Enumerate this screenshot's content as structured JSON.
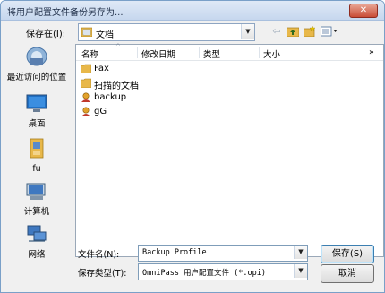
{
  "window": {
    "title": "将用户配置文件备份另存为...",
    "close_symbol": "✕"
  },
  "lookin": {
    "label": "保存在(I):",
    "value": "文档"
  },
  "toolbar": {
    "back_symbol": "⇦",
    "up_symbol": "⇧",
    "new_folder_symbol": "✦",
    "view_symbol": "▦▾"
  },
  "places": [
    {
      "label": "最近访问的位置",
      "icon": "recent-places-icon"
    },
    {
      "label": "桌面",
      "icon": "desktop-icon"
    },
    {
      "label": "fu",
      "icon": "user-folder-icon"
    },
    {
      "label": "计算机",
      "icon": "computer-icon"
    },
    {
      "label": "网络",
      "icon": "network-icon"
    }
  ],
  "columns": {
    "name": "名称",
    "date": "修改日期",
    "type": "类型",
    "size": "大小",
    "more": "»"
  },
  "files": [
    {
      "name": "Fax",
      "icon": "folder-icon"
    },
    {
      "name": "扫描的文档",
      "icon": "folder-icon"
    },
    {
      "name": "backup",
      "icon": "user-profile-icon"
    },
    {
      "name": "gG",
      "icon": "user-profile-icon"
    }
  ],
  "filename": {
    "label": "文件名(N):",
    "value": "Backup Profile"
  },
  "filetype": {
    "label": "保存类型(T):",
    "value": "OmniPass 用户配置文件 (*.opi)"
  },
  "buttons": {
    "save": "保存(S)",
    "cancel": "取消"
  },
  "colors": {
    "title_bar": "#c6d7ee",
    "close_button": "#c94c36",
    "folder": "#e8b84a",
    "dialog_bg": "#f0f0f0"
  }
}
